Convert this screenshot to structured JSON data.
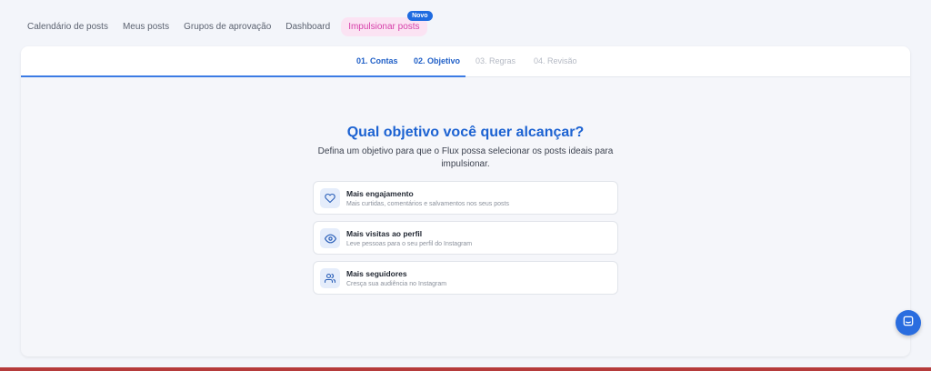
{
  "nav": {
    "items": [
      {
        "label": "Calendário de posts"
      },
      {
        "label": "Meus posts"
      },
      {
        "label": "Grupos de aprovação"
      },
      {
        "label": "Dashboard"
      }
    ],
    "promo": {
      "label": "Impulsionar posts",
      "badge": "Novo"
    }
  },
  "steps": [
    {
      "label": "01. Contas",
      "state": "done"
    },
    {
      "label": "02. Objetivo",
      "state": "active"
    },
    {
      "label": "03. Regras",
      "state": "pending"
    },
    {
      "label": "04. Revisão",
      "state": "pending"
    }
  ],
  "main": {
    "heading": "Qual objetivo você quer alcançar?",
    "subtitle": "Defina um objetivo para que o Flux possa selecionar os posts ideais para impulsionar."
  },
  "options": [
    {
      "icon": "heart-icon",
      "title": "Mais engajamento",
      "desc": "Mais curtidas, comentários e salvamentos nos seus posts"
    },
    {
      "icon": "eye-icon",
      "title": "Mais visitas ao perfil",
      "desc": "Leve pessoas para o seu perfil do Instagram"
    },
    {
      "icon": "users-icon",
      "title": "Mais seguidores",
      "desc": "Cresça sua audiência no Instagram"
    }
  ],
  "colors": {
    "accent": "#1d63d2",
    "promo_bg": "#fbe3f3",
    "promo_text": "#d63fa9",
    "badge": "#1f6be0"
  }
}
